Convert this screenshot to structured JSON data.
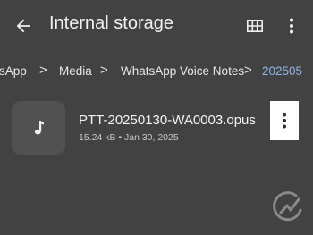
{
  "appbar": {
    "title": "Internal storage",
    "icons": {
      "back": "arrow-left-icon",
      "view": "grid-view-icon",
      "menu": "more-vertical-icon"
    }
  },
  "breadcrumb": {
    "items": [
      "sApp",
      "Media",
      "WhatsApp Voice Notes",
      "202505"
    ],
    "separator": ">"
  },
  "files": [
    {
      "name": "PTT-20250130-WA0003.opus",
      "size": "15.24 kB",
      "separator": "•",
      "date": "Jan 30, 2025",
      "icon": "music-note-icon",
      "action_icon": "more-vertical-icon"
    }
  ],
  "colors": {
    "background": "#424242",
    "thumbnail": "#515151",
    "text": "#f1f1f1",
    "active_crumb": "#90b4e6",
    "highlight": "#ffffff"
  },
  "watermark": {
    "icon": "logo-watermark-icon"
  }
}
